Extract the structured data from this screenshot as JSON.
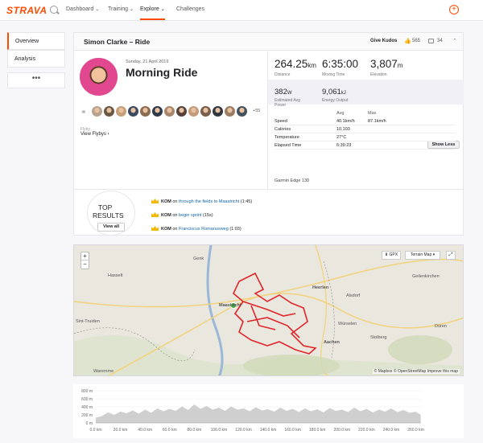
{
  "nav": {
    "logo": "STRAVA",
    "items": [
      {
        "label": "Dashboard",
        "chevron": true,
        "active": false
      },
      {
        "label": "Training",
        "chevron": true,
        "active": false
      },
      {
        "label": "Explore",
        "chevron": true,
        "active": true
      },
      {
        "label": "Challenges",
        "chevron": false,
        "active": false
      }
    ],
    "plus": "+"
  },
  "sidebar": {
    "items": [
      {
        "label": "Overview",
        "active": true
      },
      {
        "label": "Analysis",
        "active": false
      }
    ],
    "more": "•••"
  },
  "activity": {
    "header_title": "Simon Clarke – Ride",
    "give_kudos": "Give Kudos",
    "kudos_count": "565",
    "comment_count": "34",
    "date": "Sunday, 21 April 2019",
    "name": "Morning Ride",
    "kudoers_more": "+55",
    "flyby_label": "Flyby",
    "view_flybys": "View Flybys ›",
    "kudoer_colors": [
      "#b9a38f",
      "#6b5844",
      "#c7a07a",
      "#3b4a60",
      "#8d6b52",
      "#2f3a48",
      "#a9876d",
      "#56423a",
      "#c49c7c",
      "#7a5f4b",
      "#30373f",
      "#9c7d64",
      "#44525e"
    ]
  },
  "stats": {
    "primary": [
      {
        "value": "264.25",
        "unit": "km",
        "label": "Distance"
      },
      {
        "value": "6:35:00",
        "unit": "",
        "label": "Moving Time"
      },
      {
        "value": "3,807",
        "unit": "m",
        "label": "Elevation"
      }
    ],
    "secondary": [
      {
        "value": "382",
        "unit": "W",
        "label": "Estimated Avg Power"
      },
      {
        "value": "9,061",
        "unit": "kJ",
        "label": "Energy Output"
      }
    ],
    "table_headers": {
      "avg": "Avg",
      "max": "Max"
    },
    "rows": [
      {
        "label": "Speed",
        "avg": "40.1km/h",
        "max": "87.1km/h"
      },
      {
        "label": "Calories",
        "avg": "10,103",
        "max": ""
      },
      {
        "label": "Temperature",
        "avg": "27°C",
        "max": ""
      },
      {
        "label": "Elapsed Time",
        "avg": "6:39:23",
        "max": ""
      }
    ],
    "show_less": "Show Less",
    "device": "Garmin Edge 130"
  },
  "top_results": {
    "line1": "TOP",
    "line2": "RESULTS",
    "view_all": "View all",
    "segments": [
      {
        "badge": "KOM",
        "on": "on",
        "name": "through the fields to Maastricht",
        "time": "(1:45)"
      },
      {
        "badge": "KOM",
        "on": "on",
        "name": "begin sprint",
        "time": "(15s)"
      },
      {
        "badge": "KOM",
        "on": "on",
        "name": "Franciscus Romanusweg",
        "time": "(1:03)"
      }
    ]
  },
  "map": {
    "zoom_in": "+",
    "zoom_out": "−",
    "gpx": "⬇ GPX",
    "terrain": "Terrain Map ▾",
    "fullscreen": "⤢",
    "labels": [
      {
        "text": "Genk",
        "key": "genk"
      },
      {
        "text": "Hasselt",
        "key": "hasselt"
      },
      {
        "text": "Sint-Truiden",
        "key": "st"
      },
      {
        "text": "Maastricht",
        "key": "maas"
      },
      {
        "text": "Heerlen",
        "key": "heerlen"
      },
      {
        "text": "Aachen",
        "key": "aachen"
      },
      {
        "text": "Düren",
        "key": "duren"
      },
      {
        "text": "Waremme",
        "key": "waremme"
      },
      {
        "text": "Würselen",
        "key": "wurselen"
      },
      {
        "text": "Stolberg",
        "key": "stolberg"
      },
      {
        "text": "Alsdorf",
        "key": "alsdorf"
      },
      {
        "text": "Geilenkirchen",
        "key": "geilen"
      }
    ],
    "attribution": "© Mapbox © OpenStreetMap Improve this map",
    "route_color": "#e0262b"
  },
  "chart_data": {
    "type": "area",
    "y_ticks": [
      "800 m",
      "600 m",
      "400 m",
      "200 m",
      "0 m"
    ],
    "ylim": [
      0,
      800
    ],
    "x_ticks": [
      "0.0 km",
      "20.0 km",
      "40.0 km",
      "60.0 km",
      "80.0 km",
      "100.0 km",
      "120.0 km",
      "140.0 km",
      "160.0 km",
      "180.0 km",
      "200.0 km",
      "220.0 km",
      "240.0 km",
      "260.0 km"
    ],
    "xlim": [
      0,
      264.25
    ],
    "x": [
      0,
      5,
      10,
      15,
      20,
      25,
      30,
      35,
      40,
      45,
      50,
      55,
      60,
      65,
      70,
      75,
      80,
      85,
      90,
      95,
      100,
      105,
      110,
      115,
      120,
      125,
      130,
      135,
      140,
      145,
      150,
      155,
      160,
      165,
      170,
      175,
      180,
      185,
      190,
      195,
      200,
      205,
      210,
      215,
      220,
      225,
      230,
      235,
      240,
      245,
      250,
      255,
      260,
      264
    ],
    "values": [
      130,
      170,
      260,
      200,
      280,
      240,
      310,
      230,
      330,
      250,
      360,
      290,
      350,
      300,
      410,
      320,
      460,
      350,
      420,
      330,
      380,
      300,
      410,
      330,
      360,
      290,
      390,
      310,
      340,
      280,
      380,
      300,
      350,
      270,
      360,
      290,
      340,
      260,
      370,
      300,
      330,
      270,
      380,
      290,
      350,
      260,
      330,
      280,
      360,
      270,
      320,
      250,
      280,
      200
    ],
    "fill": "#cfcfcf"
  }
}
